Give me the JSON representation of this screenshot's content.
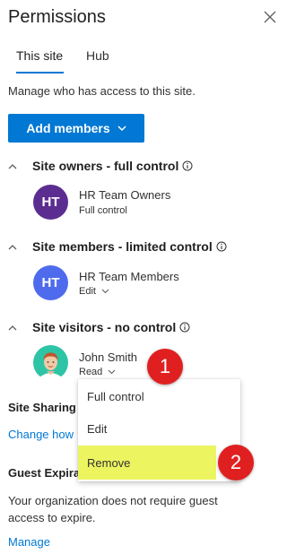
{
  "panel": {
    "title": "Permissions"
  },
  "tabs": [
    {
      "label": "This site",
      "active": true
    },
    {
      "label": "Hub",
      "active": false
    }
  ],
  "description": "Manage who has access to this site.",
  "add_members": {
    "label": "Add members"
  },
  "sections": [
    {
      "title": "Site owners - full control",
      "member": {
        "initials": "HT",
        "name": "HR Team Owners",
        "role": "Full control",
        "avatar_color": "#5c2d91"
      }
    },
    {
      "title": "Site members - limited control",
      "member": {
        "initials": "HT",
        "name": "HR Team Members",
        "role": "Edit",
        "avatar_color": "#4f6bed"
      }
    },
    {
      "title": "Site visitors - no control",
      "member": {
        "name": "John Smith",
        "role": "Read"
      }
    }
  ],
  "site_sharing": {
    "heading": "Site Sharing",
    "link": "Change how"
  },
  "guest_expiration": {
    "heading": "Guest Expiration",
    "text_line1": "Your organization does not require guest",
    "text_line2": "access to expire.",
    "link": "Manage"
  },
  "role_menu": {
    "items": [
      "Full control",
      "Edit",
      "Remove"
    ],
    "highlighted": "Remove",
    "highlight_color": "#ecf560"
  },
  "callouts": [
    "1",
    "2"
  ],
  "colors": {
    "accent": "#0078d4",
    "callout": "#e02020"
  }
}
